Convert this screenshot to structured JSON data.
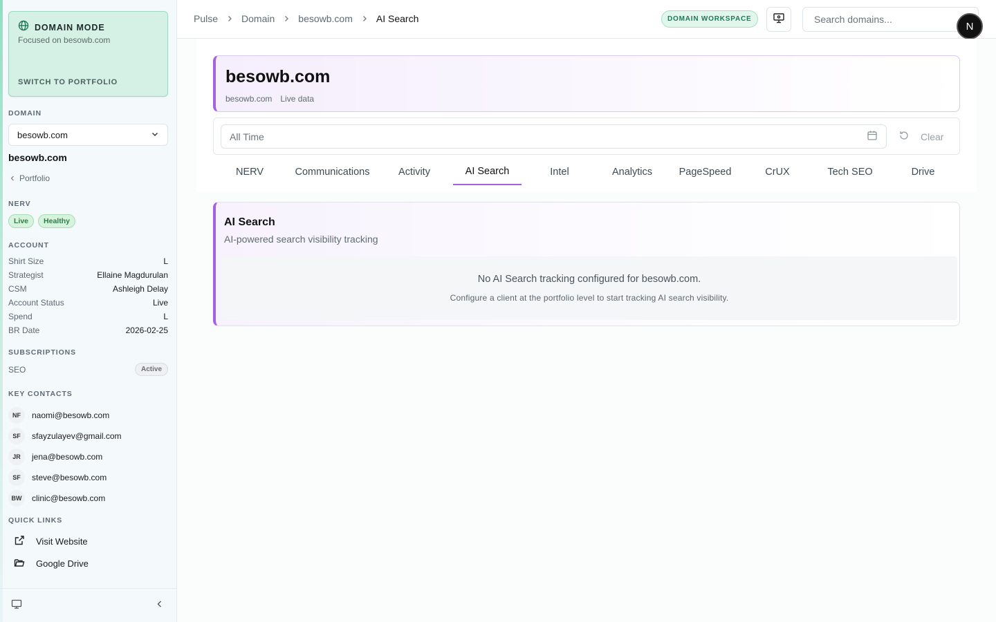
{
  "sidebar": {
    "mode": {
      "title": "DOMAIN MODE",
      "subtitle": "Focused on besowb.com",
      "switch_label": "SWITCH TO PORTFOLIO"
    },
    "domain_label": "DOMAIN",
    "domain_select_value": "besowb.com",
    "domain_name": "besowb.com",
    "portfolio_link": "Portfolio",
    "nerv": {
      "label": "NERV",
      "badges": [
        "Live",
        "Healthy"
      ]
    },
    "account": {
      "label": "ACCOUNT",
      "rows": [
        {
          "key": "Shirt Size",
          "value": "L"
        },
        {
          "key": "Strategist",
          "value": "Ellaine Magdurulan"
        },
        {
          "key": "CSM",
          "value": "Ashleigh Delay"
        },
        {
          "key": "Account Status",
          "value": "Live"
        },
        {
          "key": "Spend",
          "value": "L"
        },
        {
          "key": "BR Date",
          "value": "2026-02-25"
        }
      ]
    },
    "subscriptions": {
      "label": "SUBSCRIPTIONS",
      "items": [
        {
          "name": "SEO",
          "status": "Active"
        }
      ]
    },
    "contacts": {
      "label": "KEY CONTACTS",
      "items": [
        {
          "initials": "NF",
          "email": "naomi@besowb.com"
        },
        {
          "initials": "SF",
          "email": "sfayzulayev@gmail.com"
        },
        {
          "initials": "JR",
          "email": "jena@besowb.com"
        },
        {
          "initials": "SF",
          "email": "steve@besowb.com"
        },
        {
          "initials": "BW",
          "email": "clinic@besowb.com"
        }
      ]
    },
    "quick_links": {
      "label": "QUICK LINKS",
      "items": [
        {
          "label": "Visit Website",
          "icon": "external-link-icon"
        },
        {
          "label": "Google Drive",
          "icon": "folder-icon"
        }
      ]
    }
  },
  "topbar": {
    "breadcrumbs": [
      "Pulse",
      "Domain",
      "besowb.com",
      "AI Search"
    ],
    "workspace_badge": "DOMAIN WORKSPACE",
    "search_placeholder": "Search domains...",
    "avatar_initial": "N"
  },
  "header": {
    "title": "besowb.com",
    "meta": [
      "besowb.com",
      "Live data"
    ]
  },
  "filter": {
    "date_placeholder": "All Time",
    "clear_label": "Clear"
  },
  "tabs": [
    {
      "label": "NERV",
      "active": false
    },
    {
      "label": "Communications",
      "active": false
    },
    {
      "label": "Activity",
      "active": false
    },
    {
      "label": "AI Search",
      "active": true
    },
    {
      "label": "Intel",
      "active": false
    },
    {
      "label": "Analytics",
      "active": false
    },
    {
      "label": "PageSpeed",
      "active": false
    },
    {
      "label": "CrUX",
      "active": false
    },
    {
      "label": "Tech SEO",
      "active": false
    },
    {
      "label": "Drive",
      "active": false
    }
  ],
  "ai_search": {
    "title": "AI Search",
    "subtitle": "AI-powered search visibility tracking",
    "empty_title": "No AI Search tracking configured for besowb.com.",
    "empty_hint": "Configure a client at the portfolio level to start tracking AI search visibility."
  },
  "colors": {
    "accent_purple": "#a461e0",
    "mint": "#d5f1e6",
    "badge_green": "#2f7d47"
  }
}
